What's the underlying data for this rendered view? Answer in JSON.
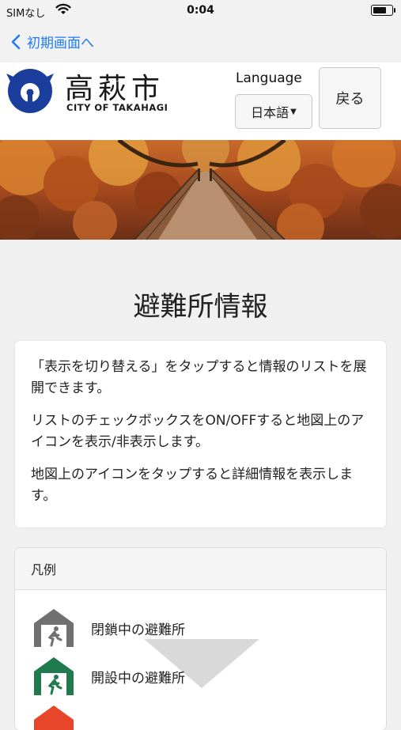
{
  "status_bar": {
    "carrier": "SIMなし",
    "time": "0:04",
    "battery_level": 0.8
  },
  "nav": {
    "back_label": "初期画面へ"
  },
  "header": {
    "logo_jp": "高萩市",
    "logo_en": "CITY OF TAKAHAGI",
    "language_label": "Language",
    "language_value": "日本語",
    "back_button": "戻る"
  },
  "page": {
    "title": "避難所情報",
    "instructions": [
      "「表示を切り替える」をタップすると情報のリストを展開できます。",
      "リストのチェックボックスをON/OFFすると地図上のアイコンを表示/非表示します。",
      "地図上のアイコンをタップすると詳細情報を表示します。"
    ]
  },
  "legend": {
    "title": "凡例",
    "items": [
      {
        "label": "閉鎖中の避難所",
        "icon": "closed-shelter-icon",
        "color": "#707070"
      },
      {
        "label": "開設中の避難所",
        "icon": "open-shelter-icon",
        "color": "#1f7a4d"
      },
      {
        "label": "",
        "icon": "shelter-icon-red",
        "color": "#e8462b"
      }
    ]
  },
  "colors": {
    "accent": "#1e7cf2",
    "emblem": "#1b3d9c"
  }
}
